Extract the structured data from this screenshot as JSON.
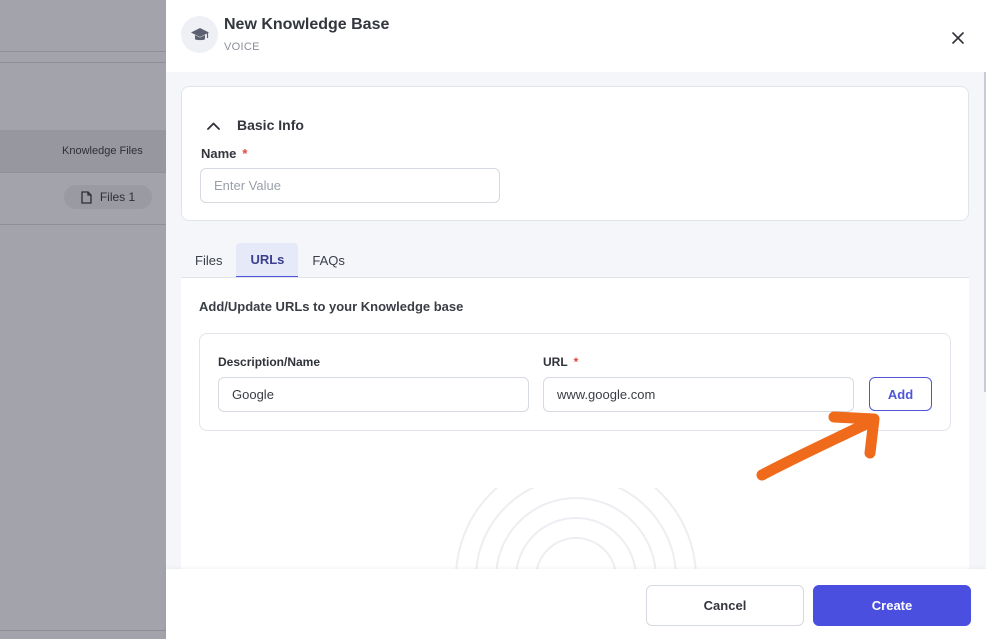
{
  "background": {
    "column_header": "Knowledge Files",
    "files_chip": "Files 1"
  },
  "drawer": {
    "title": "New Knowledge Base",
    "subtitle": "VOICE",
    "icon": "graduation-cap-icon"
  },
  "basic_info": {
    "title": "Basic Info",
    "name_label": "Name",
    "required_mark": "*",
    "name_placeholder": "Enter Value"
  },
  "tabs": [
    {
      "label": "Files",
      "active": false
    },
    {
      "label": "URLs",
      "active": true
    },
    {
      "label": "FAQs",
      "active": false
    }
  ],
  "urls": {
    "description": "Add/Update URLs to your Knowledge base",
    "desc_label": "Description/Name",
    "desc_value": "Google",
    "url_label": "URL",
    "url_value": "www.google.com",
    "add_label": "Add"
  },
  "footer": {
    "cancel_label": "Cancel",
    "create_label": "Create"
  },
  "colors": {
    "primary": "#4a4fe0",
    "annotation_arrow": "#f06a1c",
    "required": "#e0473d"
  }
}
